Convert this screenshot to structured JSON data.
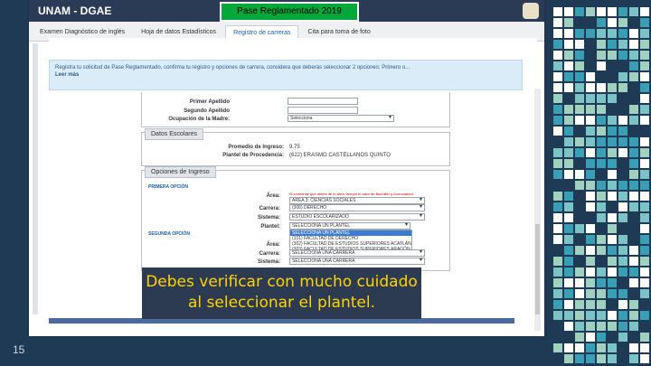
{
  "slide": {
    "title": "Pase Reglamentado 2019",
    "number": "15",
    "callout": "Debes verificar con mucho cuidado al seleccionar el plantel."
  },
  "app": {
    "title": "UNAM - DGAE",
    "logo_icon": "unam-shield-icon"
  },
  "tabs": [
    {
      "label": "Examen Diagnóstico de inglés"
    },
    {
      "label": "Hoja de datos Estadísticos"
    },
    {
      "label": "Registro de carreras",
      "active": true
    },
    {
      "label": "Cita para toma de foto"
    }
  ],
  "alert": {
    "text": "Registra tu solicitud de Pase Reglamentado, confirma tu registro y opciones de carrera, considera que deberás seleccionar 2 opciones: Primero o...",
    "read_more": "Leer más"
  },
  "personal": {
    "primer_apellido_label": "Primer Apellido",
    "segundo_apellido_label": "Segundo Apellido",
    "ocupacion_madre_label": "Ocupación de la Madre:",
    "ocupacion_madre_value": "Selecciona"
  },
  "datos_escolares": {
    "header": "Datos Escolares",
    "promedio_label": "Promedio de Ingreso:",
    "promedio_value": "9.75",
    "plantel_label": "Plantel de Procedencia:",
    "plantel_value": "(622) ERASMO CASTELLANOS QUINTO"
  },
  "opciones": {
    "header": "Opciones de Ingreso",
    "primera": {
      "title": "PRIMERA OPCIÓN",
      "area_label": "Área:",
      "area_hint": "Si combinas que debes de tu área, tiempo el valor de Bachiller y Licenciatura",
      "area_value": "AREA 3: CIENCIAS SOCIALES",
      "carrera_label": "Carrera:",
      "carrera_value": "(306) DERECHO",
      "sistema_label": "Sistema:",
      "sistema_value": "ESTUDIO ESCOLARIZADO",
      "plantel_label": "Plantel:",
      "plantel_value": "SELECCIONA UN PLANTEL",
      "plantel_options": [
        "SELECCIONA UN PLANTEL",
        "(101) FACULTAD DE DERECHO",
        "(302) FACULTAD DE ESTUDIOS SUPERIORES ACATLÁN",
        "(303) FACULTAD DE ESTUDIOS SUPERIORES ARAGÓN"
      ]
    },
    "segunda": {
      "title": "SEGUNDA OPCIÓN",
      "area_label": "Área:",
      "area_value": "",
      "carrera_label": "Carrera:",
      "carrera_value": "SELECCIONA UNA CARRERA",
      "sistema_label": "Sistema:",
      "sistema_value": "SELECCIONA UNA CARRERA"
    }
  },
  "colors": {
    "slide_bg": "#1f3a55",
    "title_box": "#00a83a",
    "callout_text": "#ffd400",
    "mosaic": [
      "#3a9fb5",
      "#9fd0c0",
      "#ffffff",
      "#1f3a55",
      "#7cc3c6"
    ]
  }
}
